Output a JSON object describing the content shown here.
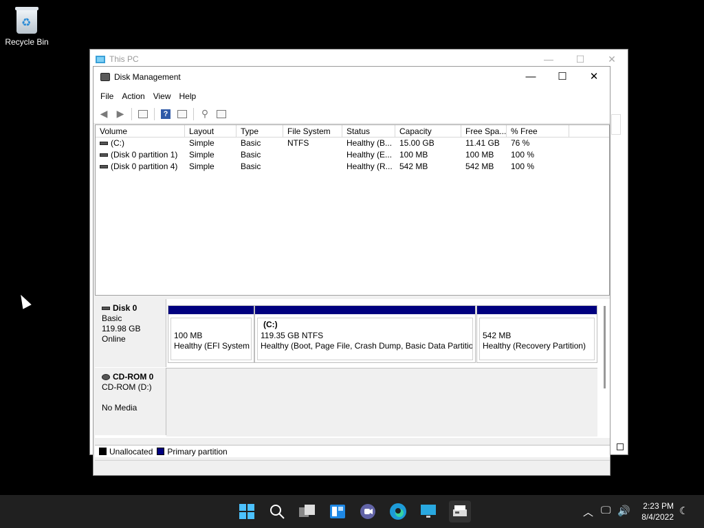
{
  "desktop": {
    "recycle_bin_label": "Recycle Bin"
  },
  "this_pc": {
    "title": "This PC"
  },
  "window": {
    "title": "Disk Management",
    "menus": [
      "File",
      "Action",
      "View",
      "Help"
    ]
  },
  "volume_table": {
    "columns": [
      "Volume",
      "Layout",
      "Type",
      "File System",
      "Status",
      "Capacity",
      "Free Spa...",
      "% Free"
    ],
    "rows": [
      [
        "(C:)",
        "Simple",
        "Basic",
        "NTFS",
        "Healthy (B...",
        "15.00 GB",
        "11.41 GB",
        "76 %"
      ],
      [
        "(Disk 0 partition 1)",
        "Simple",
        "Basic",
        "",
        "Healthy (E...",
        "100 MB",
        "100 MB",
        "100 %"
      ],
      [
        "(Disk 0 partition 4)",
        "Simple",
        "Basic",
        "",
        "Healthy (R...",
        "542 MB",
        "542 MB",
        "100 %"
      ]
    ]
  },
  "disk0": {
    "name": "Disk 0",
    "type": "Basic",
    "size": "119.98 GB",
    "state": "Online",
    "partitions": [
      {
        "name": "",
        "size": "100 MB",
        "status": "Healthy (EFI System Partition)"
      },
      {
        "name": "(C:)",
        "size": "119.35 GB NTFS",
        "status": "Healthy (Boot, Page File, Crash Dump, Basic Data Partition)"
      },
      {
        "name": "",
        "size": "542 MB",
        "status": "Healthy (Recovery Partition)"
      }
    ]
  },
  "cdrom": {
    "name": "CD-ROM 0",
    "type": "CD-ROM (D:)",
    "media": "No Media"
  },
  "legend": {
    "unallocated": "Unallocated",
    "primary": "Primary partition"
  },
  "colors": {
    "unallocated": "#000000",
    "primary": "#00007f"
  },
  "taskbar": {
    "time": "2:23 PM",
    "date": "8/4/2022"
  }
}
